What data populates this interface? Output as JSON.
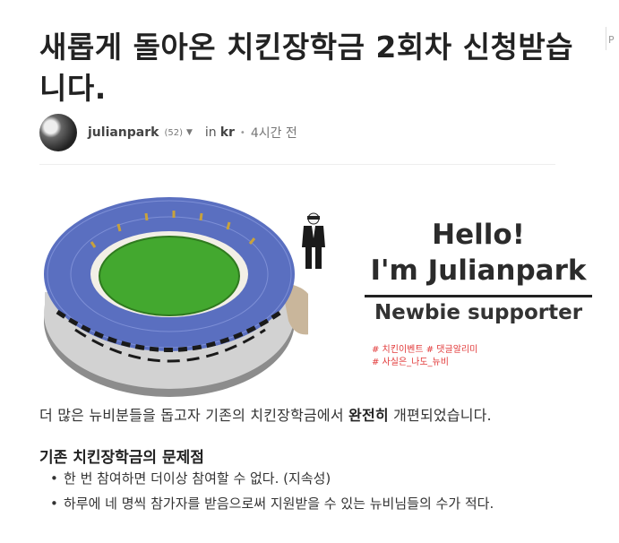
{
  "post": {
    "title": "새롭게 돌아온 치킨장학금 2회차 신청받습니다.",
    "author": "julianpark",
    "reputation": "(52)",
    "in_label": "in",
    "category": "kr",
    "separator": "•",
    "time": "4시간 전"
  },
  "side_tab": {
    "label": "P"
  },
  "banner": {
    "hello_line1": "Hello!",
    "hello_line2": "I'm Julianpark",
    "subtitle": "Newbie supporter",
    "tag_line1": "# 치킨이벤트 # 댓글알리미",
    "tag_line2": "# 사실은_나도_뉴비"
  },
  "body": {
    "intro_before": "더 많은 뉴비분들을 돕고자 기존의 치킨장학금에서 ",
    "intro_bold": "완전히",
    "intro_after": " 개편되었습니다.",
    "subheading": "기존 치킨장학금의 문제점",
    "bullets": [
      "한 번 참여하면 더이상 참여할 수 없다. (지속성)",
      "하루에 네 명씩 참가자를 받음으로써 지원받을 수 있는 뉴비님들의 수가 적다."
    ]
  },
  "colors": {
    "stadium_seats": "#5a6fc0",
    "field": "#43a82f",
    "tag_red": "#e23b3b"
  }
}
